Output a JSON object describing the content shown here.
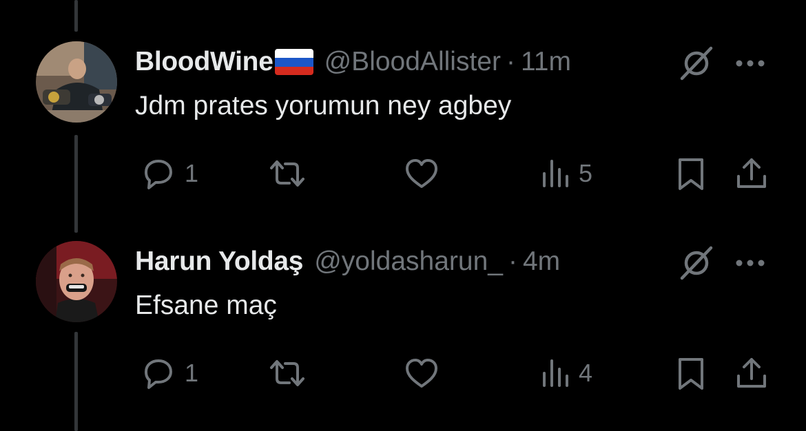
{
  "colors": {
    "background": "#000000",
    "text_primary": "#e7e9ea",
    "text_secondary": "#71767b",
    "thread_line": "#333639"
  },
  "tweets": [
    {
      "name": "BloodWine",
      "has_flag": true,
      "flag": "russia-flag",
      "handle": "@BloodAllister",
      "separator": "·",
      "time": "11m",
      "text": "Jdm prates yorumun ney agbey",
      "replies": "1",
      "retweets": "",
      "likes": "",
      "views": "5",
      "icons": [
        "reply-icon",
        "retweet-icon",
        "like-icon",
        "views-icon",
        "bookmark-icon",
        "share-icon",
        "grok-icon",
        "more-icon"
      ]
    },
    {
      "name": "Harun Yoldaş",
      "has_flag": false,
      "handle": "@yoldasharun_",
      "separator": "·",
      "time": "4m",
      "text": "Efsane maç",
      "replies": "1",
      "retweets": "",
      "likes": "",
      "views": "4",
      "icons": [
        "reply-icon",
        "retweet-icon",
        "like-icon",
        "views-icon",
        "bookmark-icon",
        "share-icon",
        "grok-icon",
        "more-icon"
      ]
    }
  ]
}
